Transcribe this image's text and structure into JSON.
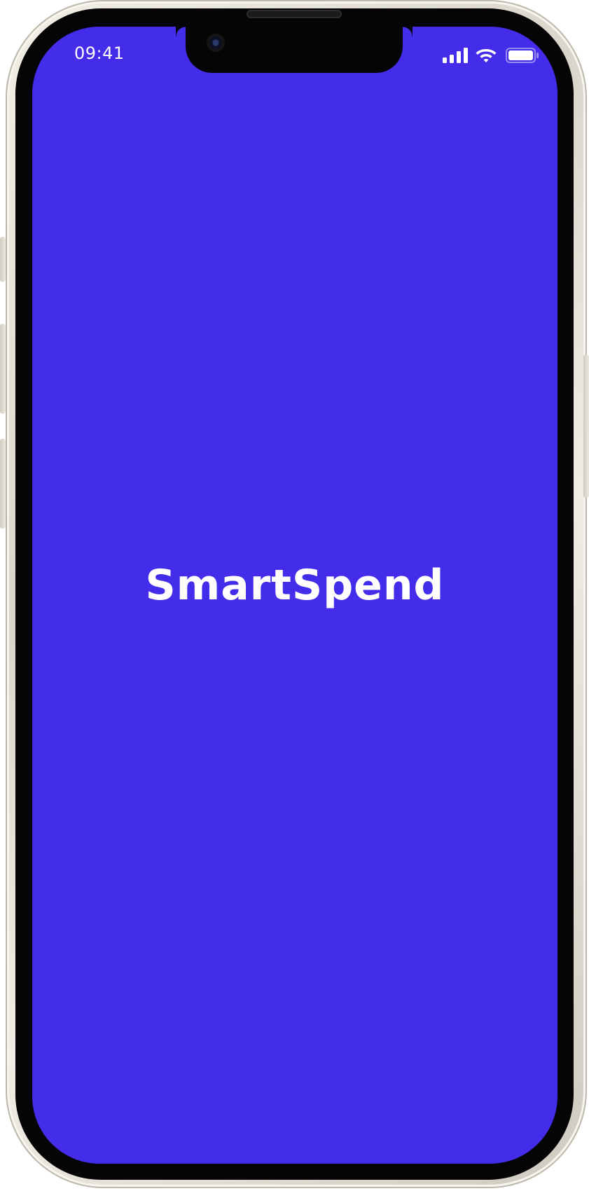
{
  "status_bar": {
    "time": "09:41",
    "signal_icon": "cellular-signal-icon",
    "wifi_icon": "wifi-icon",
    "battery_icon": "battery-icon"
  },
  "splash": {
    "app_name": "SmartSpend",
    "background_color": "#432deb",
    "text_color": "#ffffff"
  }
}
